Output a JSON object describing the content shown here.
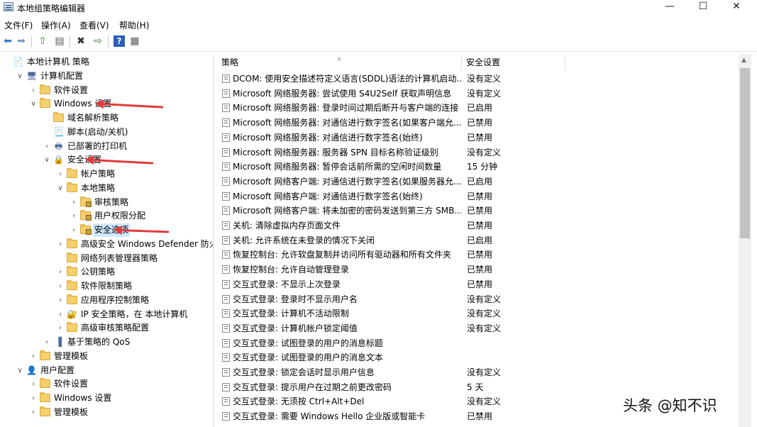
{
  "window": {
    "title": "本地组策略编辑器",
    "controls": {
      "minimize": "—",
      "maximize": "☐",
      "close": "✕"
    }
  },
  "menu": [
    "文件(F)",
    "操作(A)",
    "查看(V)",
    "帮助(H)"
  ],
  "toolbar_icons": [
    "back-icon",
    "forward-icon",
    "up-folder-icon",
    "show-hide-tree-icon",
    "delete-icon",
    "export-icon",
    "help-icon",
    "properties-icon"
  ],
  "tree": [
    {
      "label": "本地计算机 策略",
      "indent": 0,
      "icon": "computer-policy-icon",
      "twisty": ""
    },
    {
      "label": "计算机配置",
      "indent": 1,
      "icon": "computer-icon",
      "twisty": "v"
    },
    {
      "label": "软件设置",
      "indent": 2,
      "icon": "folder-icon",
      "twisty": ">"
    },
    {
      "label": "Windows 设置",
      "indent": 2,
      "icon": "folder-icon",
      "twisty": "v"
    },
    {
      "label": "域名解析策略",
      "indent": 3,
      "icon": "folder-icon",
      "twisty": ""
    },
    {
      "label": "脚本(启动/关机)",
      "indent": 3,
      "icon": "script-icon",
      "twisty": ""
    },
    {
      "label": "已部署的打印机",
      "indent": 3,
      "icon": "printer-icon",
      "twisty": ">"
    },
    {
      "label": "安全设置",
      "indent": 3,
      "icon": "security-settings-icon",
      "twisty": "v"
    },
    {
      "label": "帐户策略",
      "indent": 4,
      "icon": "folder-icon",
      "twisty": ">"
    },
    {
      "label": "本地策略",
      "indent": 4,
      "icon": "folder-icon",
      "twisty": "v"
    },
    {
      "label": "审核策略",
      "indent": 5,
      "icon": "lock-folder-icon",
      "twisty": ">"
    },
    {
      "label": "用户权限分配",
      "indent": 5,
      "icon": "lock-folder-icon",
      "twisty": ">"
    },
    {
      "label": "安全选项",
      "indent": 5,
      "icon": "lock-folder-icon",
      "twisty": ">",
      "selected": true
    },
    {
      "label": "高级安全 Windows Defender 防火墙",
      "indent": 4,
      "icon": "folder-icon",
      "twisty": ">"
    },
    {
      "label": "网络列表管理器策略",
      "indent": 4,
      "icon": "folder-icon",
      "twisty": ""
    },
    {
      "label": "公钥策略",
      "indent": 4,
      "icon": "folder-icon",
      "twisty": ">"
    },
    {
      "label": "软件限制策略",
      "indent": 4,
      "icon": "folder-icon",
      "twisty": ">"
    },
    {
      "label": "应用程序控制策略",
      "indent": 4,
      "icon": "folder-icon",
      "twisty": ">"
    },
    {
      "label": "IP 安全策略，在 本地计算机",
      "indent": 4,
      "icon": "ip-security-icon",
      "twisty": ">"
    },
    {
      "label": "高级审核策略配置",
      "indent": 4,
      "icon": "folder-icon",
      "twisty": ">"
    },
    {
      "label": "基于策略的 QoS",
      "indent": 3,
      "icon": "qos-chart-icon",
      "twisty": ">"
    },
    {
      "label": "管理模板",
      "indent": 2,
      "icon": "folder-icon",
      "twisty": ">"
    },
    {
      "label": "用户配置",
      "indent": 1,
      "icon": "user-icon",
      "twisty": "v"
    },
    {
      "label": "软件设置",
      "indent": 2,
      "icon": "folder-icon",
      "twisty": ">"
    },
    {
      "label": "Windows 设置",
      "indent": 2,
      "icon": "folder-icon",
      "twisty": ">"
    },
    {
      "label": "管理模板",
      "indent": 2,
      "icon": "folder-icon",
      "twisty": ">"
    }
  ],
  "list": {
    "columns": [
      "策略",
      "安全设置"
    ],
    "rows": [
      {
        "policy": "DCOM: 使用安全描述符定义语言(SDDL)语法的计算机启动...",
        "setting": "没有定义"
      },
      {
        "policy": "Microsoft 网络服务器: 尝试使用 S4U2Self 获取声明信息",
        "setting": "没有定义"
      },
      {
        "policy": "Microsoft 网络服务器: 登录时间过期后断开与客户端的连接",
        "setting": "已启用"
      },
      {
        "policy": "Microsoft 网络服务器: 对通信进行数字签名(如果客户端允...",
        "setting": "已禁用"
      },
      {
        "policy": "Microsoft 网络服务器: 对通信进行数字签名(始终)",
        "setting": "已禁用"
      },
      {
        "policy": "Microsoft 网络服务器: 服务器 SPN 目标名称验证级别",
        "setting": "没有定义"
      },
      {
        "policy": "Microsoft 网络服务器: 暂停会话前所需的空闲时间数量",
        "setting": "15 分钟"
      },
      {
        "policy": "Microsoft 网络客户端: 对通信进行数字签名(如果服务器允...",
        "setting": "已启用"
      },
      {
        "policy": "Microsoft 网络客户端: 对通信进行数字签名(始终)",
        "setting": "已禁用"
      },
      {
        "policy": "Microsoft 网络客户端: 将未加密的密码发送到第三方 SMB...",
        "setting": "已禁用"
      },
      {
        "policy": "关机: 清除虚拟内存页面文件",
        "setting": "已禁用"
      },
      {
        "policy": "关机: 允许系统在未登录的情况下关闭",
        "setting": "已启用"
      },
      {
        "policy": "恢复控制台: 允许软盘复制并访问所有驱动器和所有文件夹",
        "setting": "已禁用"
      },
      {
        "policy": "恢复控制台: 允许自动管理登录",
        "setting": "已禁用"
      },
      {
        "policy": "交互式登录: 不显示上次登录",
        "setting": "已禁用"
      },
      {
        "policy": "交互式登录: 登录时不显示用户名",
        "setting": "没有定义"
      },
      {
        "policy": "交互式登录: 计算机不活动限制",
        "setting": "没有定义"
      },
      {
        "policy": "交互式登录: 计算机帐户锁定阈值",
        "setting": "没有定义"
      },
      {
        "policy": "交互式登录: 试图登录的用户的消息标题",
        "setting": ""
      },
      {
        "policy": "交互式登录: 试图登录的用户的消息文本",
        "setting": ""
      },
      {
        "policy": "交互式登录: 锁定会话时显示用户信息",
        "setting": "没有定义"
      },
      {
        "policy": "交互式登录: 提示用户在过期之前更改密码",
        "setting": "5 天"
      },
      {
        "policy": "交互式登录: 无须按 Ctrl+Alt+Del",
        "setting": "没有定义"
      },
      {
        "policy": "交互式登录: 需要 Windows Hello 企业版或智能卡",
        "setting": "已禁用"
      }
    ]
  },
  "watermark": "头条 @知不识",
  "colors": {
    "annotation_arrow": "#e03a3a",
    "selection": "#cde8ff"
  }
}
